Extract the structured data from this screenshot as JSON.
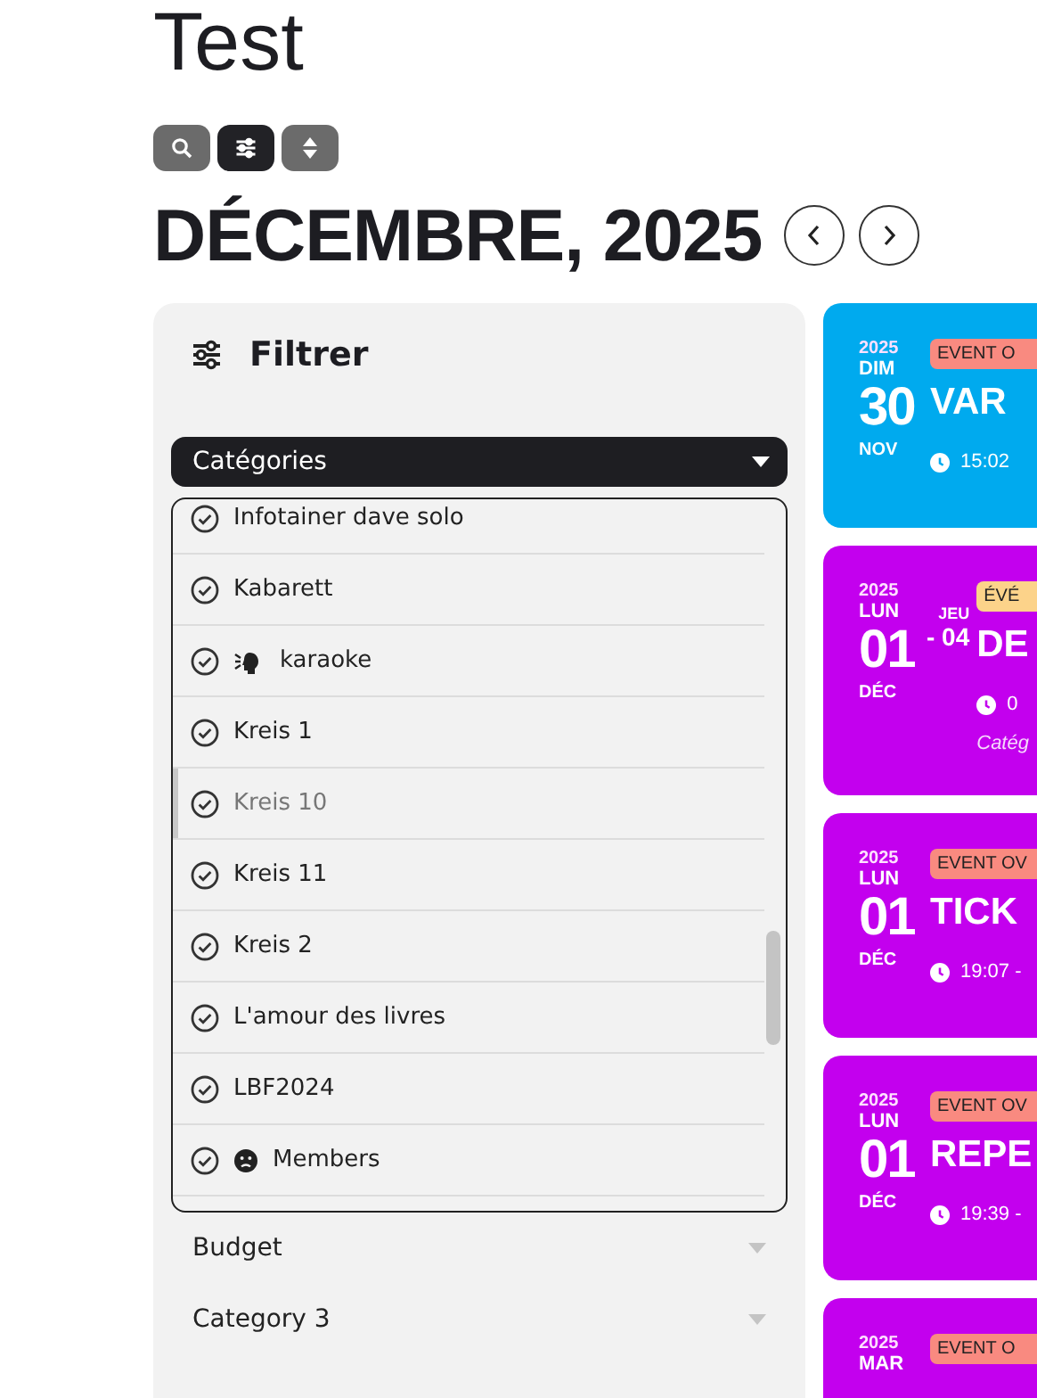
{
  "page_title": "Test",
  "toolbar": [
    {
      "kind": "search",
      "selected": false
    },
    {
      "kind": "filter",
      "selected": true
    },
    {
      "kind": "sort",
      "selected": false
    }
  ],
  "month_heading": "DÉCEMBRE, 2025",
  "filter": {
    "title": "Filtrer",
    "dropdown": {
      "label": "Catégories",
      "expanded": true
    },
    "items": [
      {
        "label": "Infotainer dave solo",
        "kind": "plain",
        "checked": true,
        "highlighted": false
      },
      {
        "label": "Kabarett",
        "kind": "plain",
        "checked": true,
        "highlighted": false
      },
      {
        "label": "karaoke",
        "kind": "speaking",
        "checked": true,
        "highlighted": false
      },
      {
        "label": "Kreis 1",
        "kind": "plain",
        "checked": true,
        "highlighted": false
      },
      {
        "label": "Kreis 10",
        "kind": "plain",
        "checked": true,
        "highlighted": true
      },
      {
        "label": "Kreis 11",
        "kind": "plain",
        "checked": true,
        "highlighted": false
      },
      {
        "label": "Kreis 2",
        "kind": "plain",
        "checked": true,
        "highlighted": false
      },
      {
        "label": "L'amour des livres",
        "kind": "plain",
        "checked": true,
        "highlighted": false
      },
      {
        "label": "LBF2024",
        "kind": "plain",
        "checked": true,
        "highlighted": false
      },
      {
        "label": "Members",
        "kind": "face",
        "checked": true,
        "highlighted": false
      }
    ],
    "collapsed": [
      {
        "label": "Budget",
        "expanded": false
      },
      {
        "label": "Category 3",
        "expanded": false
      }
    ]
  },
  "events": [
    {
      "color": "#00aaee",
      "year": "2025",
      "weekday": "DIM",
      "day": "30",
      "month": "NOV",
      "badge": {
        "text": "EVENT O",
        "color": "#f98a80"
      },
      "title": "VAR",
      "time": "15:02"
    },
    {
      "color": "#c300ee",
      "year": "2025",
      "weekday": "LUN",
      "day": "01",
      "month": "DÉC",
      "end": {
        "weekday": "JEU",
        "day": "- 04"
      },
      "badge": {
        "text": "ÉVÉ",
        "color": "#fcd38a"
      },
      "title": "DE",
      "time": "0",
      "category": "Catég"
    },
    {
      "color": "#c300ee",
      "year": "2025",
      "weekday": "LUN",
      "day": "01",
      "month": "DÉC",
      "badge": {
        "text": "EVENT OV",
        "color": "#f98a80"
      },
      "title": "TICK",
      "time": "19:07 -"
    },
    {
      "color": "#c300ee",
      "year": "2025",
      "weekday": "LUN",
      "day": "01",
      "month": "DÉC",
      "badge": {
        "text": "EVENT OV",
        "color": "#f98a80"
      },
      "title": "REPE",
      "time": "19:39 -"
    },
    {
      "color": "#c300ee",
      "year": "2025",
      "weekday": "MAR",
      "badge": {
        "text": "EVENT O",
        "color": "#f98a80"
      }
    }
  ]
}
